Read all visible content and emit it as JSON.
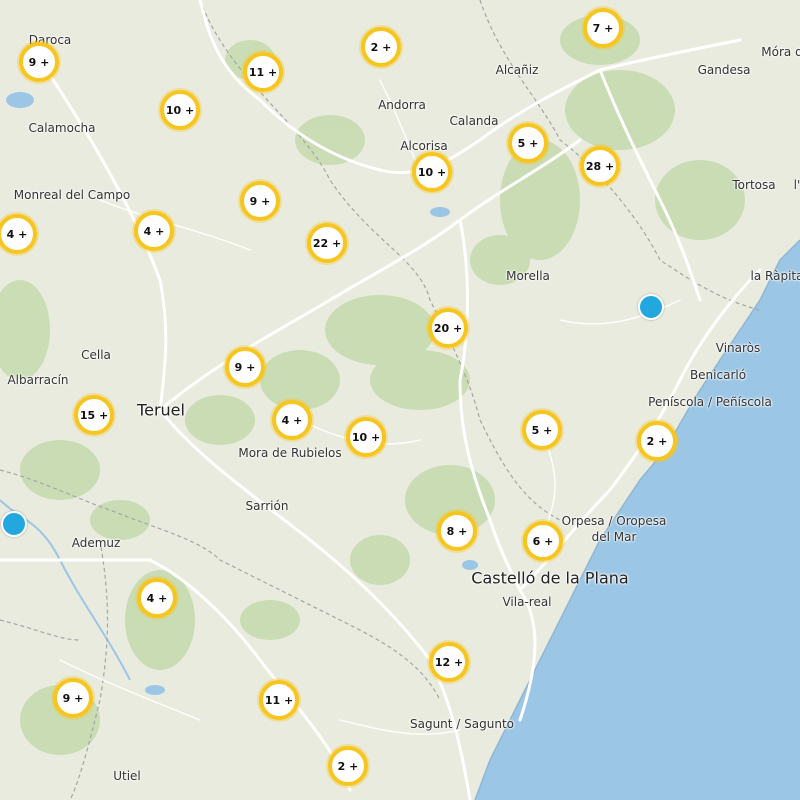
{
  "colors": {
    "sea": "#9cc6e6",
    "land": "#e9ebdf",
    "forest": "#c6dbb0",
    "road": "#ffffff",
    "cluster_ring": "#f7c520",
    "marker": "#22a7df"
  },
  "places": [
    {
      "id": "daroca",
      "name": "Daroca"
    },
    {
      "id": "alcaniz",
      "name": "Alcañiz"
    },
    {
      "id": "gandesa",
      "name": "Gandesa"
    },
    {
      "id": "mora",
      "name": "Móra d"
    },
    {
      "id": "andorra",
      "name": "Andorra"
    },
    {
      "id": "calanda",
      "name": "Calanda"
    },
    {
      "id": "calamocha",
      "name": "Calamocha"
    },
    {
      "id": "alcorisa",
      "name": "Alcorisa"
    },
    {
      "id": "tortosa",
      "name": "Tortosa"
    },
    {
      "id": "l",
      "name": "l'"
    },
    {
      "id": "monreal",
      "name": "Monreal del Campo"
    },
    {
      "id": "morella",
      "name": "Morella"
    },
    {
      "id": "rapita",
      "name": "la Ràpita"
    },
    {
      "id": "vinaros",
      "name": "Vinaròs"
    },
    {
      "id": "cella",
      "name": "Cella"
    },
    {
      "id": "benicarlo",
      "name": "Benicarló"
    },
    {
      "id": "albarracin",
      "name": "Albarracín"
    },
    {
      "id": "teruel",
      "name": "Teruel"
    },
    {
      "id": "peniscola",
      "name": "Peníscola / Peñíscola"
    },
    {
      "id": "mora_rubielos",
      "name": "Mora de Rubielos"
    },
    {
      "id": "sarrion",
      "name": "Sarrión"
    },
    {
      "id": "orpesa1",
      "name": "Orpesa / Oropesa"
    },
    {
      "id": "orpesa2",
      "name": "del Mar"
    },
    {
      "id": "ademuz",
      "name": "Ademuz"
    },
    {
      "id": "castello",
      "name": "Castelló de la Plana"
    },
    {
      "id": "vilareal",
      "name": "Vila-real"
    },
    {
      "id": "sagunt",
      "name": "Sagunt / Sagunto"
    },
    {
      "id": "utiel",
      "name": "Utiel"
    }
  ],
  "clusters": [
    {
      "id": "c1",
      "label": "9 +"
    },
    {
      "id": "c2",
      "label": "11 +"
    },
    {
      "id": "c3",
      "label": "2 +"
    },
    {
      "id": "c4",
      "label": "7 +"
    },
    {
      "id": "c5",
      "label": "10 +"
    },
    {
      "id": "c6",
      "label": "5 +"
    },
    {
      "id": "c7",
      "label": "10 +"
    },
    {
      "id": "c8",
      "label": "28 +"
    },
    {
      "id": "c9",
      "label": "9 +"
    },
    {
      "id": "c10",
      "label": "4 +"
    },
    {
      "id": "c11",
      "label": "4 +"
    },
    {
      "id": "c12",
      "label": "22 +"
    },
    {
      "id": "c13",
      "label": "20 +"
    },
    {
      "id": "c14",
      "label": "9 +"
    },
    {
      "id": "c15",
      "label": "15 +"
    },
    {
      "id": "c16",
      "label": "4 +"
    },
    {
      "id": "c17",
      "label": "10 +"
    },
    {
      "id": "c18",
      "label": "5 +"
    },
    {
      "id": "c19",
      "label": "2 +"
    },
    {
      "id": "c20",
      "label": "8 +"
    },
    {
      "id": "c21",
      "label": "6 +"
    },
    {
      "id": "c22",
      "label": "4 +"
    },
    {
      "id": "c23",
      "label": "12 +"
    },
    {
      "id": "c24",
      "label": "9 +"
    },
    {
      "id": "c25",
      "label": "11 +"
    },
    {
      "id": "c26",
      "label": "2 +"
    }
  ],
  "markers": [
    {
      "id": "m1",
      "name": "location-marker"
    },
    {
      "id": "m2",
      "name": "location-marker"
    }
  ]
}
